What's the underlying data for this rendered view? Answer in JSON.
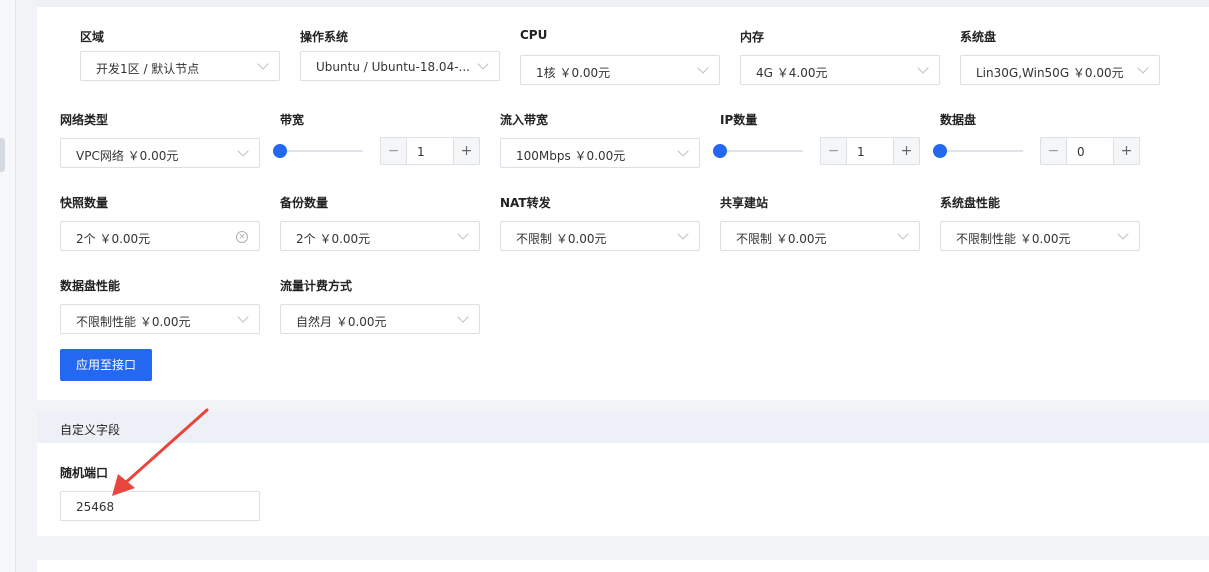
{
  "row1": {
    "region": {
      "label": "区域",
      "value": "开发1区 / 默认节点"
    },
    "os": {
      "label": "操作系统",
      "value": "Ubuntu / Ubuntu-18.04-..."
    },
    "cpu": {
      "label": "CPU",
      "value": "1核 ￥0.00元"
    },
    "memory": {
      "label": "内存",
      "value": "4G ￥4.00元"
    },
    "system_disk": {
      "label": "系统盘",
      "value": "Lin30G,Win50G ￥0.00元"
    }
  },
  "row2": {
    "network": {
      "label": "网络类型",
      "value": "VPC网络 ￥0.00元"
    },
    "bandwidth": {
      "label": "带宽",
      "value": "1",
      "slider_level": 0
    },
    "inbound": {
      "label": "流入带宽",
      "value": "100Mbps ￥0.00元"
    },
    "ip_count": {
      "label": "IP数量",
      "value": "1",
      "slider_level": 0
    },
    "data_disk": {
      "label": "数据盘",
      "value": "0",
      "slider_level": 0
    }
  },
  "row3": {
    "snapshot": {
      "label": "快照数量",
      "value": "2个 ￥0.00元"
    },
    "backup": {
      "label": "备份数量",
      "value": "2个 ￥0.00元"
    },
    "nat": {
      "label": "NAT转发",
      "value": "不限制 ￥0.00元"
    },
    "shared_site": {
      "label": "共享建站",
      "value": "不限制 ￥0.00元"
    },
    "sys_disk_perf": {
      "label": "系统盘性能",
      "value": "不限制性能 ￥0.00元"
    }
  },
  "row4": {
    "data_disk_perf": {
      "label": "数据盘性能",
      "value": "不限制性能 ￥0.00元"
    },
    "traffic_billing": {
      "label": "流量计费方式",
      "value": "自然月 ￥0.00元"
    }
  },
  "apply_button": "应用至接口",
  "custom_fields": {
    "title": "自定义字段",
    "random_port": {
      "label": "随机端口",
      "value": "25468"
    }
  },
  "stepper_signs": {
    "minus": "−",
    "plus": "+"
  },
  "clear_glyph": "×",
  "colors": {
    "accent": "#2468f2",
    "annotation": "#e8453c",
    "section_header": "#eef0f7"
  }
}
